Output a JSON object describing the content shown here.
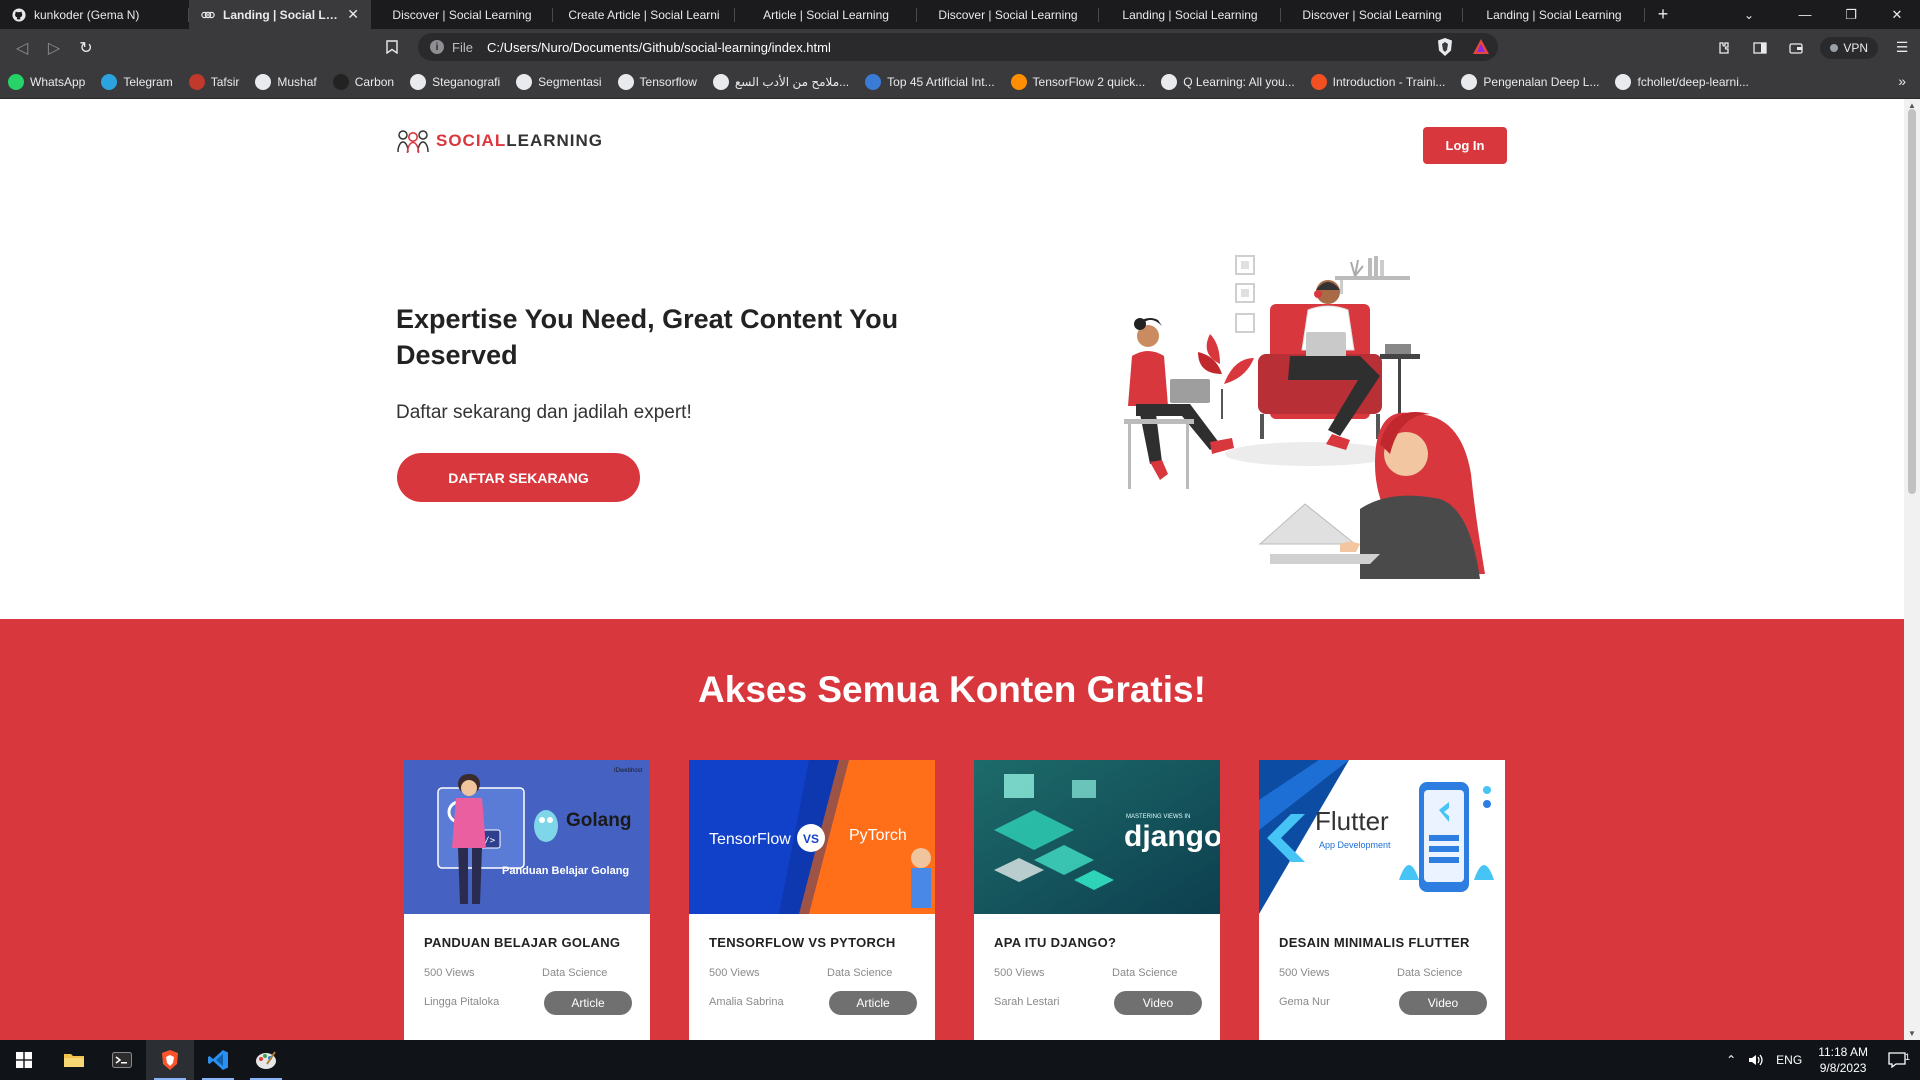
{
  "browser": {
    "tabs": [
      {
        "title": "kunkoder (Gema N)",
        "icon": "github-icon",
        "active": false
      },
      {
        "title": "Landing | Social Learnin",
        "icon": "social-learning-icon",
        "active": true
      },
      {
        "title": "Discover | Social Learning",
        "icon": "none",
        "active": false
      },
      {
        "title": "Create Article | Social Learni",
        "icon": "none",
        "active": false
      },
      {
        "title": "Article | Social Learning",
        "icon": "none",
        "active": false
      },
      {
        "title": "Discover | Social Learning",
        "icon": "none",
        "active": false
      },
      {
        "title": "Landing | Social Learning",
        "icon": "none",
        "active": false
      },
      {
        "title": "Discover | Social Learning",
        "icon": "none",
        "active": false
      },
      {
        "title": "Landing | Social Learning",
        "icon": "none",
        "active": false
      }
    ],
    "address": {
      "scheme_label": "File",
      "url": "C:/Users/Nuro/Documents/Github/social-learning/index.html"
    },
    "vpn_label": "VPN",
    "bookmarks": [
      {
        "label": "WhatsApp",
        "icon": "whatsapp-icon",
        "color": "#25d366"
      },
      {
        "label": "Telegram",
        "icon": "telegram-icon",
        "color": "#2aa3e0"
      },
      {
        "label": "Tafsir",
        "icon": "tafsir-icon",
        "color": "#c0392b"
      },
      {
        "label": "Mushaf",
        "icon": "mushaf-icon",
        "color": "#e8eaed"
      },
      {
        "label": "Carbon",
        "icon": "carbon-icon",
        "color": "#222222"
      },
      {
        "label": "Steganografi",
        "icon": "github-icon",
        "color": "#e8eaed"
      },
      {
        "label": "Segmentasi",
        "icon": "medium-icon",
        "color": "#e8eaed"
      },
      {
        "label": "Tensorflow",
        "icon": "github-icon",
        "color": "#e8eaed"
      },
      {
        "label": "ملامح من الأدب السع...",
        "icon": "globe-icon",
        "color": "#e8eaed"
      },
      {
        "label": "Top 45 Artificial Int...",
        "icon": "article-icon",
        "color": "#3a7bd5"
      },
      {
        "label": "TensorFlow 2 quick...",
        "icon": "tensorflow-icon",
        "color": "#ff8f00"
      },
      {
        "label": "Q Learning: All you...",
        "icon": "medium-icon",
        "color": "#e8eaed"
      },
      {
        "label": "Introduction - Traini...",
        "icon": "microsoft-icon",
        "color": "#f25022"
      },
      {
        "label": "Pengenalan Deep L...",
        "icon": "medium-icon",
        "color": "#e8eaed"
      },
      {
        "label": "fchollet/deep-learni...",
        "icon": "github-icon",
        "color": "#e8eaed"
      }
    ]
  },
  "page": {
    "logo": {
      "part1": "SOCIAL",
      "part2": "LEARNING"
    },
    "login_label": "Log In",
    "hero": {
      "title": "Expertise You Need, Great Content You Deserved",
      "subtitle": "Daftar sekarang dan jadilah expert!",
      "cta_label": "DAFTAR SEKARANG"
    },
    "section_title": "Akses Semua Konten Gratis!",
    "cards": [
      {
        "title": "PANDUAN BELAJAR GOLANG",
        "views": "500 Views",
        "category": "Data Science",
        "author": "Lingga Pitaloka",
        "type": "Article",
        "img_text": "Golang",
        "img_sub": "Panduan Belajar Golang",
        "img_badge": "IDwebhost"
      },
      {
        "title": "TENSORFLOW VS PYTORCH",
        "views": "500 Views",
        "category": "Data Science",
        "author": "Amalia Sabrina",
        "type": "Article",
        "img_left": "TensorFlow",
        "img_vs": "VS",
        "img_right": "PyTorch"
      },
      {
        "title": "APA ITU DJANGO?",
        "views": "500 Views",
        "category": "Data Science",
        "author": "Sarah Lestari",
        "type": "Video",
        "img_text": "django",
        "img_small": "MASTERING VIEWS IN"
      },
      {
        "title": "DESAIN MINIMALIS FLUTTER",
        "views": "500 Views",
        "category": "Data Science",
        "author": "Gema Nur",
        "type": "Video",
        "img_text": "Flutter",
        "img_sub": "App Development"
      }
    ]
  },
  "taskbar": {
    "apps": [
      {
        "name": "file-explorer-icon",
        "active": false
      },
      {
        "name": "terminal-icon",
        "active": false
      },
      {
        "name": "brave-icon",
        "active": true
      },
      {
        "name": "vscode-icon",
        "active": false
      },
      {
        "name": "paint-icon",
        "active": false
      }
    ],
    "language": "ENG",
    "time": "11:18 AM",
    "date": "9/8/2023",
    "notification_count": "1"
  },
  "colors": {
    "brand_red": "#d9373e",
    "dark_text": "#222222",
    "muted": "#8a8a8a",
    "type_badge": "#707070"
  }
}
